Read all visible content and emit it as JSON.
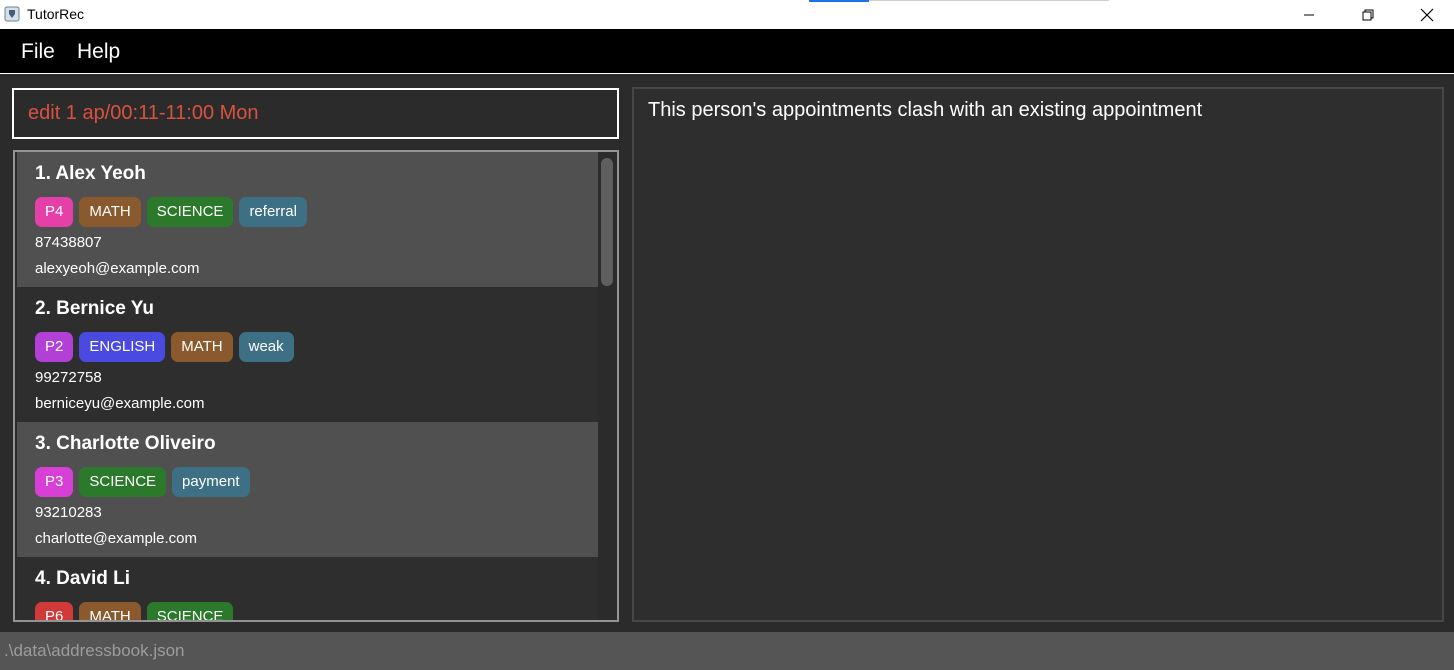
{
  "window": {
    "title": "TutorRec",
    "minimize_icon": "minimize-icon",
    "maximize_icon": "restore-icon",
    "close_icon": "close-icon"
  },
  "menu": {
    "file": "File",
    "help": "Help"
  },
  "command": {
    "value": "edit 1 ap/00:11-11:00 Mon"
  },
  "result": {
    "text": "This person's appointments clash with an existing appointment"
  },
  "persons": [
    {
      "name": "1.  Alex Yeoh",
      "tags": [
        {
          "label": "P4",
          "color": "#e540a8"
        },
        {
          "label": "MATH",
          "color": "#8a5a2e"
        },
        {
          "label": "SCIENCE",
          "color": "#2b7a2b"
        },
        {
          "label": "referral",
          "color": "#3d6f85"
        }
      ],
      "phone": "87438807",
      "email": "alexyeoh@example.com"
    },
    {
      "name": "2.  Bernice Yu",
      "tags": [
        {
          "label": "P2",
          "color": "#b23fd6"
        },
        {
          "label": "ENGLISH",
          "color": "#4a4ae0"
        },
        {
          "label": "MATH",
          "color": "#8a5a2e"
        },
        {
          "label": "weak",
          "color": "#3d6f85"
        }
      ],
      "phone": "99272758",
      "email": "berniceyu@example.com"
    },
    {
      "name": "3.  Charlotte Oliveiro",
      "tags": [
        {
          "label": "P3",
          "color": "#d83fd6"
        },
        {
          "label": "SCIENCE",
          "color": "#2b7a2b"
        },
        {
          "label": "payment",
          "color": "#3d6f85"
        }
      ],
      "phone": "93210283",
      "email": "charlotte@example.com"
    },
    {
      "name": "4.  David Li",
      "tags": [
        {
          "label": "P6",
          "color": "#d23a3a"
        },
        {
          "label": "MATH",
          "color": "#8a5a2e"
        },
        {
          "label": "SCIENCE",
          "color": "#2b7a2b"
        }
      ],
      "phone": "",
      "email": ""
    }
  ],
  "status": {
    "path": ".\\data\\addressbook.json"
  },
  "colors": {
    "command_text": "#d9523f",
    "card_odd": "#505050",
    "card_even": "#2e2e2e"
  }
}
